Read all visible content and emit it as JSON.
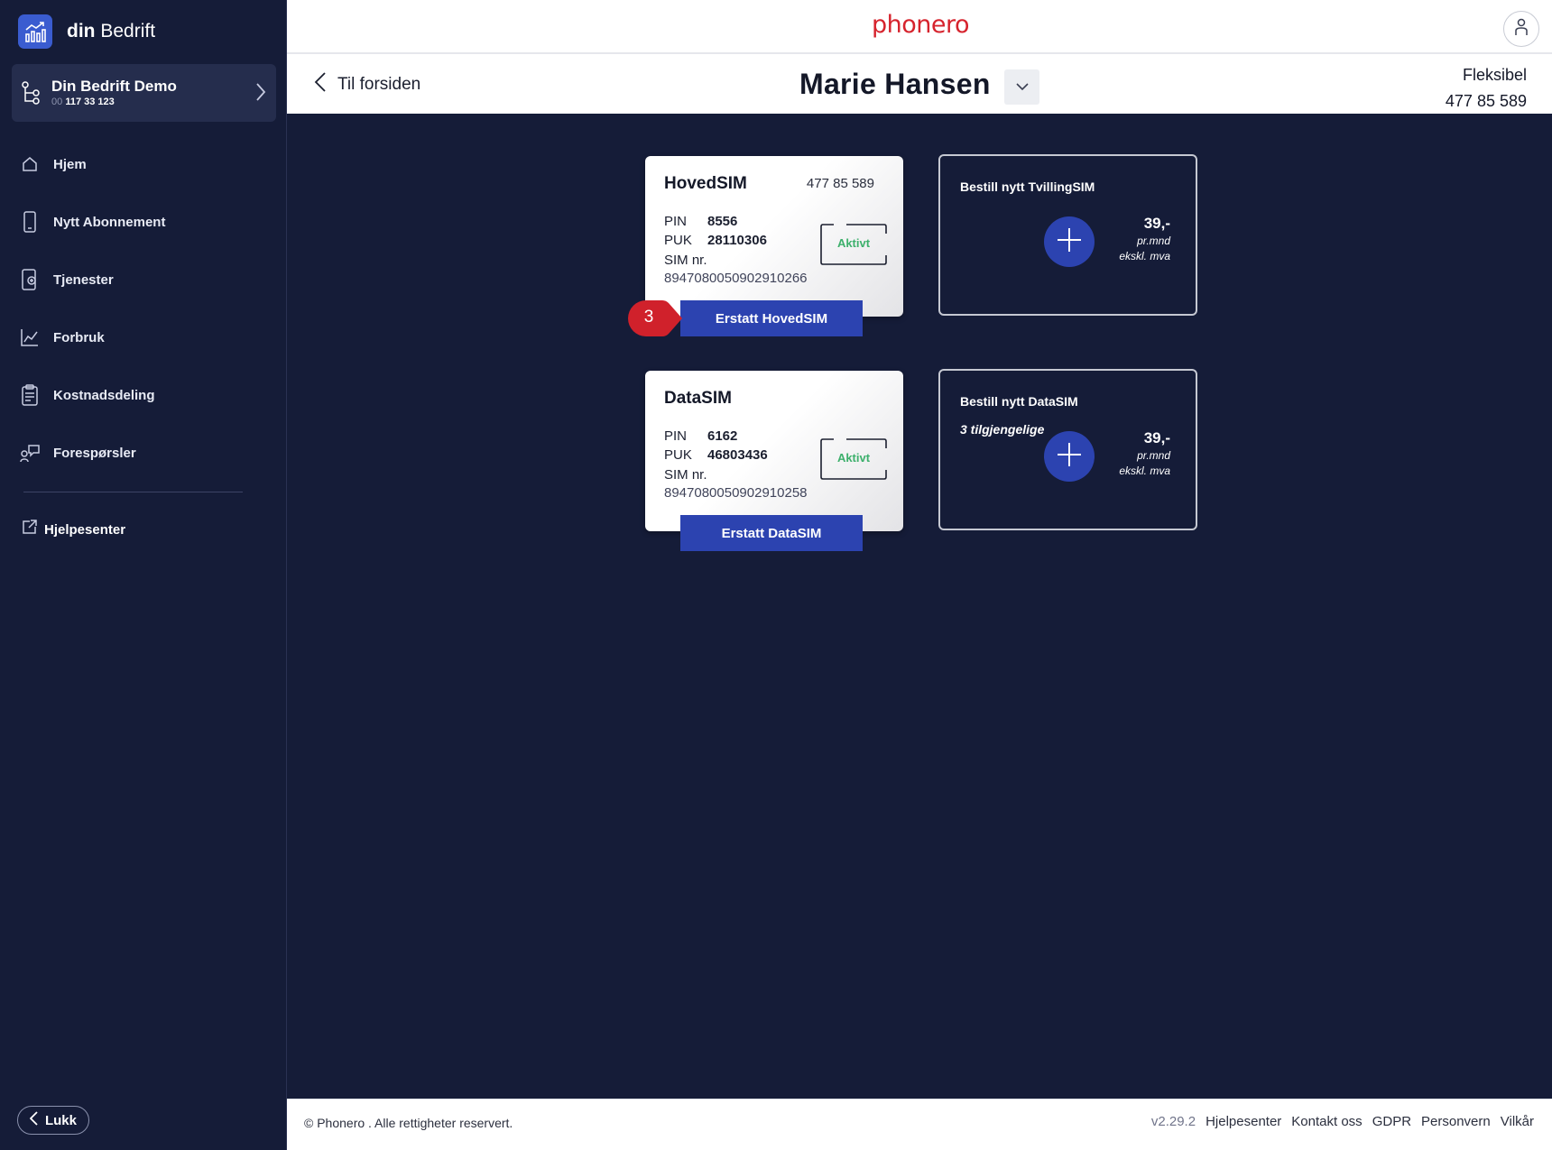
{
  "colors": {
    "sidebar_bg": "#151c38",
    "main_bg": "#151c38",
    "accent_blue": "#2c43b0",
    "brand_red": "#d6232d",
    "active_green": "#3db06c"
  },
  "sidebar": {
    "brand": {
      "bold": "din",
      "rest": " Bedrift",
      "icon": "chart-icon"
    },
    "company": {
      "name": "Din Bedrift Demo",
      "org_prefix": "00",
      "org_number": "117 33 123",
      "icon": "hierarchy-icon"
    },
    "items": [
      {
        "label": "Hjem",
        "icon": "home-icon"
      },
      {
        "label": "Nytt Abonnement",
        "icon": "phone-icon"
      },
      {
        "label": "Tjenester",
        "icon": "services-icon"
      },
      {
        "label": "Forbruk",
        "icon": "usage-icon"
      },
      {
        "label": "Kostnadsdeling",
        "icon": "clipboard-icon"
      },
      {
        "label": "Forespørsler",
        "icon": "requests-icon"
      }
    ],
    "help": {
      "label": "Hjelpesenter",
      "icon": "external-link-icon"
    },
    "close_label": "Lukk"
  },
  "topbar": {
    "brand": "phonero",
    "avatar_icon": "user-icon"
  },
  "subheader": {
    "back_label": "Til forsiden",
    "person_name": "Marie Hansen",
    "plan_name": "Fleksibel",
    "plan_number": "477 85 589"
  },
  "sims": [
    {
      "title": "HovedSIM",
      "number": "477 85 589",
      "pin_label": "PIN",
      "pin": "8556",
      "puk_label": "PUK",
      "puk": "28110306",
      "simnr_label": "SIM nr.",
      "iccid": "8947080050902910266",
      "status": "Aktivt",
      "button": "Erstatt HovedSIM"
    },
    {
      "title": "DataSIM",
      "pin_label": "PIN",
      "pin": "6162",
      "puk_label": "PUK",
      "puk": "46803436",
      "simnr_label": "SIM nr.",
      "iccid": "8947080050902910258",
      "status": "Aktivt",
      "button": "Erstatt DataSIM"
    }
  ],
  "orders": [
    {
      "title": "Bestill nytt TvillingSIM",
      "price": "39,-",
      "per": "pr.mnd",
      "vat": "ekskl. mva"
    },
    {
      "title": "Bestill nytt DataSIM",
      "available": "3 tilgjengelige",
      "price": "39,-",
      "per": "pr.mnd",
      "vat": "ekskl. mva"
    }
  ],
  "step_badge": "3",
  "footer": {
    "copyright": "© Phonero . Alle rettigheter reservert.",
    "version": "v2.29.2",
    "links": [
      "Hjelpesenter",
      "Kontakt oss",
      "GDPR",
      "Personvern",
      "Vilkår"
    ]
  }
}
